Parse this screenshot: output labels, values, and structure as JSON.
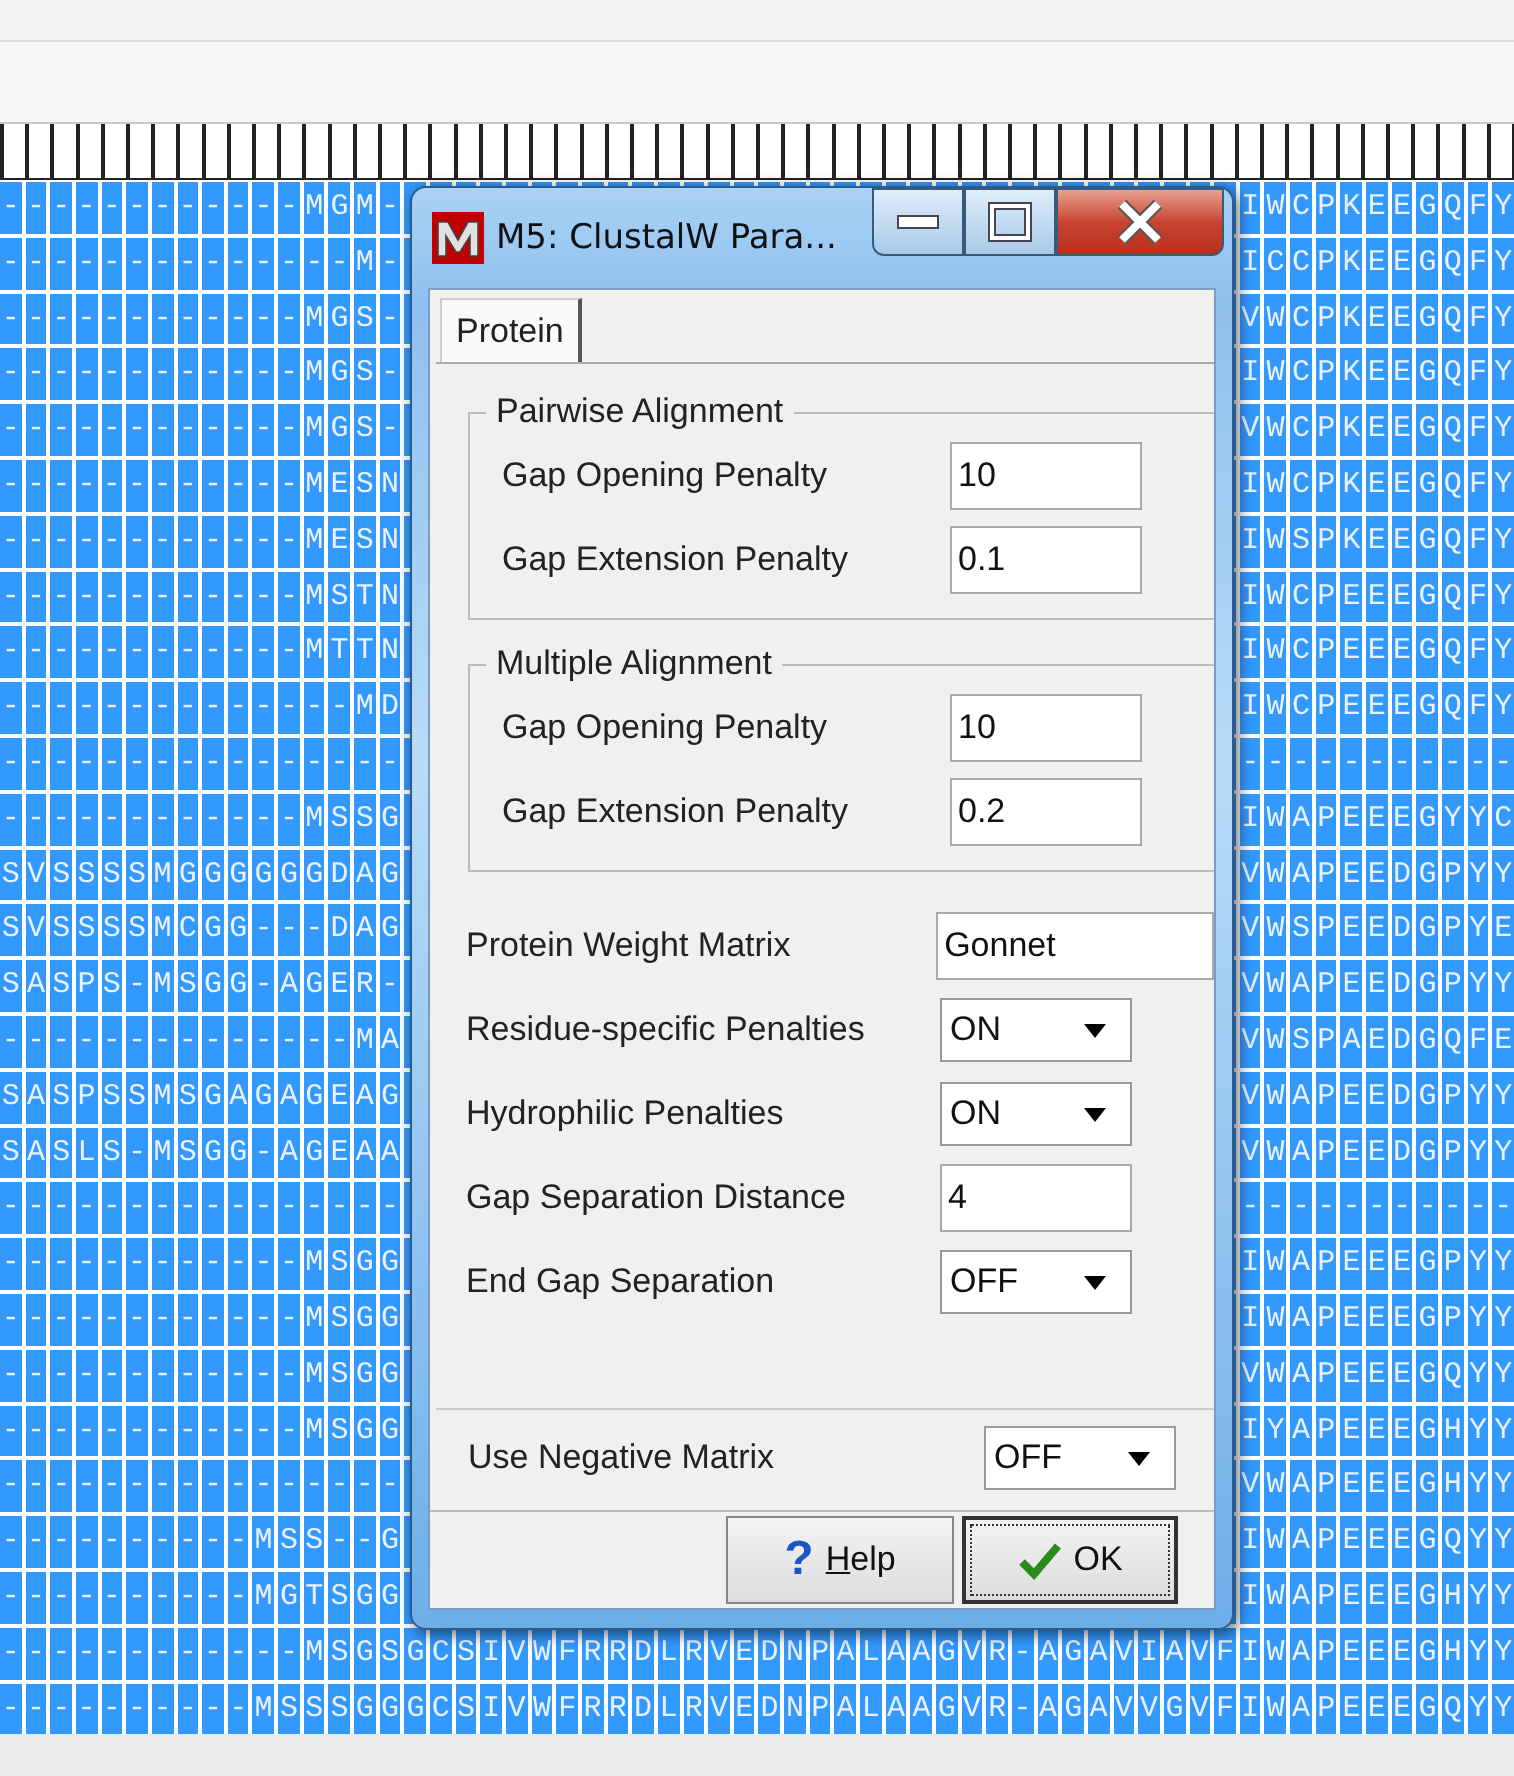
{
  "window": {
    "title": "M5: ClustalW Para..."
  },
  "tabs": [
    {
      "label": "Protein",
      "selected": true
    }
  ],
  "groups": [
    {
      "title": "Pairwise Alignment",
      "fields": [
        {
          "label": "Gap Opening Penalty",
          "value": "10"
        },
        {
          "label": "Gap Extension Penalty",
          "value": "0.1"
        }
      ]
    },
    {
      "title": "Multiple Alignment",
      "fields": [
        {
          "label": "Gap Opening Penalty",
          "value": "10"
        },
        {
          "label": "Gap Extension Penalty",
          "value": "0.2"
        }
      ]
    }
  ],
  "settings": [
    {
      "kind": "text",
      "label": "Protein Weight Matrix",
      "value": "Gonnet"
    },
    {
      "kind": "dropdown",
      "label": "Residue-specific Penalties",
      "value": "ON"
    },
    {
      "kind": "dropdown",
      "label": "Hydrophilic Penalties",
      "value": "ON"
    },
    {
      "kind": "number",
      "label": "Gap Separation Distance",
      "value": "4"
    },
    {
      "kind": "dropdown",
      "label": "End Gap Separation",
      "value": "OFF"
    }
  ],
  "negative_matrix": {
    "kind": "dropdown",
    "label": "Use Negative Matrix",
    "value": "OFF"
  },
  "buttons": [
    {
      "kind": "help",
      "icon": "?",
      "label": "Help"
    },
    {
      "kind": "ok",
      "label": "OK"
    }
  ],
  "alignment": {
    "rows": [
      {
        "left": "------------MGM-",
        "right": "IWCPKEEGQFY"
      },
      {
        "left": "--------------M-",
        "right": "ICCPKEEGQFY"
      },
      {
        "left": "------------MGS-",
        "right": "VWCPKEEGQFY"
      },
      {
        "left": "------------MGS-",
        "right": "IWCPKEEGQFY"
      },
      {
        "left": "------------MGS-",
        "right": "VWCPKEEGQFY"
      },
      {
        "left": "------------MESN",
        "right": "IWCPKEEGQFY"
      },
      {
        "left": "------------MESN",
        "right": "IWSPKEEGQFY"
      },
      {
        "left": "------------MSTN",
        "right": "IWCPEEEGQFY"
      },
      {
        "left": "------------MTTN",
        "right": "IWCPEEEGQFY"
      },
      {
        "left": "--------------MD",
        "right": "IWCPEEEGQFY"
      },
      {
        "left": "----------------",
        "right": "-----------"
      },
      {
        "left": "------------MSSG",
        "right": "IWAPEEEGYYC"
      },
      {
        "left": "SVSSSSMGGGGGGDAG",
        "right": "VWAPEEDGPYY"
      },
      {
        "left": "SVSSSSMCGG---DAG",
        "right": "VWSPEEDGPYE"
      },
      {
        "left": "SASPS-MSGG-AGER-",
        "right": "VWAPEEDGPYY"
      },
      {
        "left": "--------------MA",
        "right": "VWSPAEDGQFE"
      },
      {
        "left": "SASPSSMSGAGAGEAG",
        "right": "VWAPEEDGPYY"
      },
      {
        "left": "SASLS-MSGG-AGEAA",
        "right": "VWAPEEDGPYY"
      },
      {
        "left": "----------------",
        "right": "-----------"
      },
      {
        "left": "------------MSGG",
        "right": "IWAPEEEGPYY"
      },
      {
        "left": "------------MSGG",
        "right": "IWAPEEEGPYY"
      },
      {
        "left": "------------MSGG",
        "right": "VWAPEEEGQYY"
      },
      {
        "left": "------------MSGG",
        "right": "IYAPEEEGHYY"
      },
      {
        "left": "----------------",
        "right": "VWAPEEEGHYY"
      },
      {
        "left": "----------MSS--G",
        "right": "IWAPEEEGQYY"
      },
      {
        "left": "----------MGTSGG",
        "right": "IWAPEEEGHYY"
      },
      {
        "left": "------------MSGS",
        "middle": "GCSIVWFRRDLRVEDNPALAAGVR-AGAVIAVF",
        "right": "IWAPEEEGHYY"
      },
      {
        "left": "----------MSSSGG",
        "middle": "GCSIVWFRRDLRVEDNPALAAGVR-AGAVVGVF",
        "right": "IWAPEEEGQYY"
      }
    ]
  }
}
